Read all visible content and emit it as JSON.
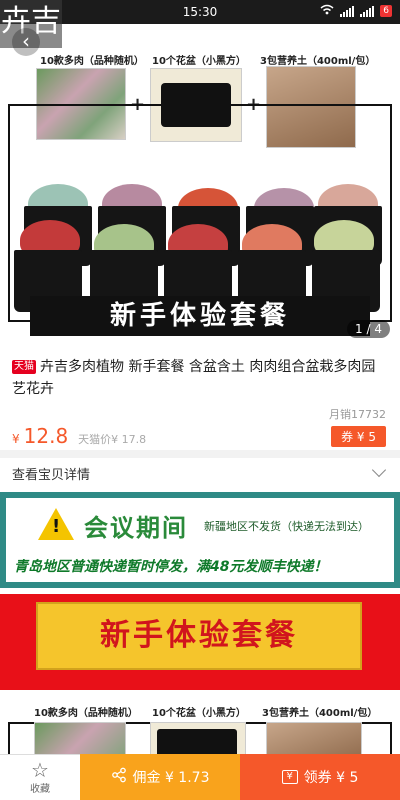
{
  "status_bar": {
    "time": "15:30",
    "battery": "6",
    "logo_text": "卉吉"
  },
  "hero": {
    "labels": [
      "10款多肉（品种随机）",
      "10个花盆（小黑方）",
      "3包营养土（400ml/包）"
    ],
    "banner_text": "新手体验套餐",
    "pager": "1 / 4"
  },
  "product": {
    "tmall_badge": "天猫",
    "title": "卉吉多肉植物 新手套餐 含盆含土 肉肉组合盆栽多肉园艺花卉",
    "monthly_sales": "月销17732",
    "price_currency": "¥",
    "price": "12.8",
    "original_price": "天猫价¥ 17.8",
    "coupon": "券 ¥ 5"
  },
  "details": {
    "label": "查看宝贝详情"
  },
  "notice": {
    "title": "会议期间",
    "subtitle": "新疆地区不发货（快递无法到达）",
    "line": "青岛地区普通快递暂时停发，满48元发顺丰快递！"
  },
  "lower_banner": {
    "title": "新手体验套餐",
    "labels": [
      "10款多肉（品种随机）",
      "10个花盆（小黑方）",
      "3包营养土（400ml/包）"
    ]
  },
  "bottom_bar": {
    "favorite_label": "收藏",
    "commission_label": "佣金 ¥ 1.73",
    "coupon_label": "领券 ¥ 5"
  }
}
